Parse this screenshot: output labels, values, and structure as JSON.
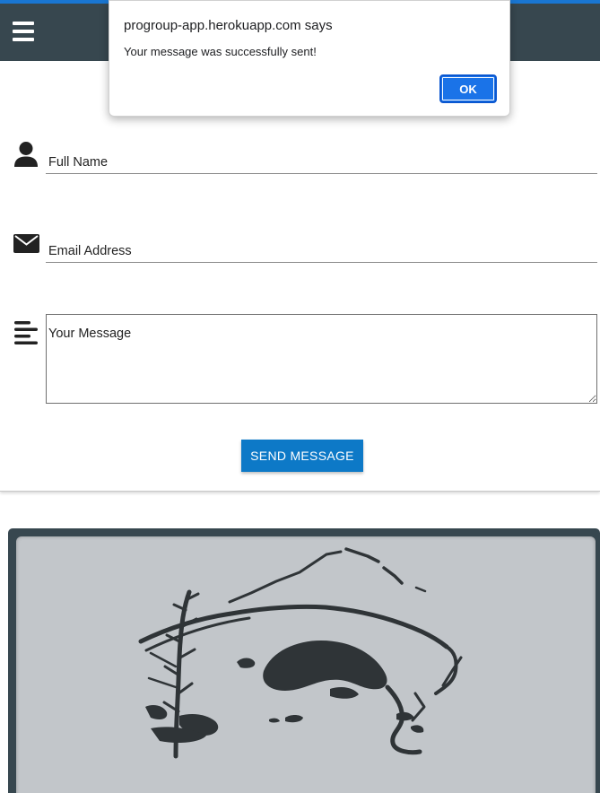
{
  "dialog": {
    "title": "progroup-app.herokuapp.com says",
    "message": "Your message was successfully sent!",
    "ok_label": "OK"
  },
  "form": {
    "name_placeholder": "Full Name",
    "email_placeholder": "Email Address",
    "message_placeholder": "Your Message",
    "send_label": "SEND MESSAGE"
  },
  "icons": {
    "menu": "hamburger-icon",
    "name": "user-icon",
    "email": "envelope-icon",
    "message": "align-left-icon"
  },
  "colors": {
    "topbar": "#37474f",
    "accent_line": "#1976d2",
    "send_button": "#0d79c7",
    "dialog_ok": "#1a73e8",
    "art_frame": "#37474f",
    "art_background": "#c2c6ca",
    "ink": "#2f3437"
  }
}
